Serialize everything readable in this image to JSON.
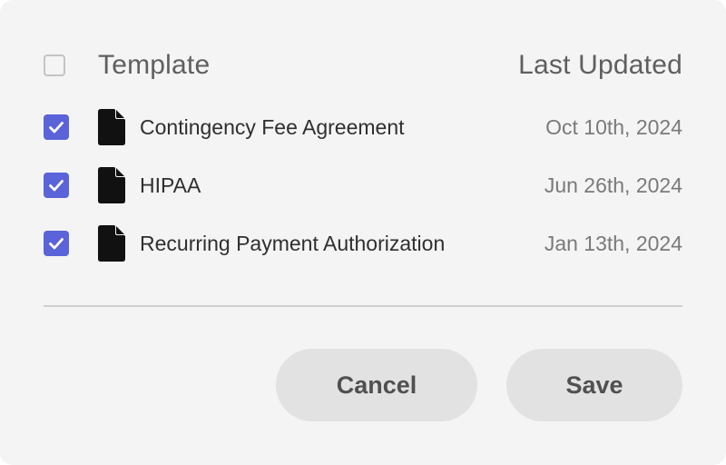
{
  "header": {
    "template_label": "Template",
    "updated_label": "Last Updated",
    "select_all_checked": false
  },
  "templates": [
    {
      "name": "Contingency Fee Agreement",
      "date": "Oct 10th, 2024",
      "checked": true,
      "icon": "document-icon"
    },
    {
      "name": "HIPAA",
      "date": "Jun 26th, 2024",
      "checked": true,
      "icon": "document-icon"
    },
    {
      "name": "Recurring Payment Authorization",
      "date": "Jan 13th, 2024",
      "checked": true,
      "icon": "document-icon"
    }
  ],
  "actions": {
    "cancel_label": "Cancel",
    "save_label": "Save"
  },
  "colors": {
    "accent": "#5b63d9",
    "panel_bg": "#f4f4f4",
    "button_bg": "#e2e2e2"
  }
}
